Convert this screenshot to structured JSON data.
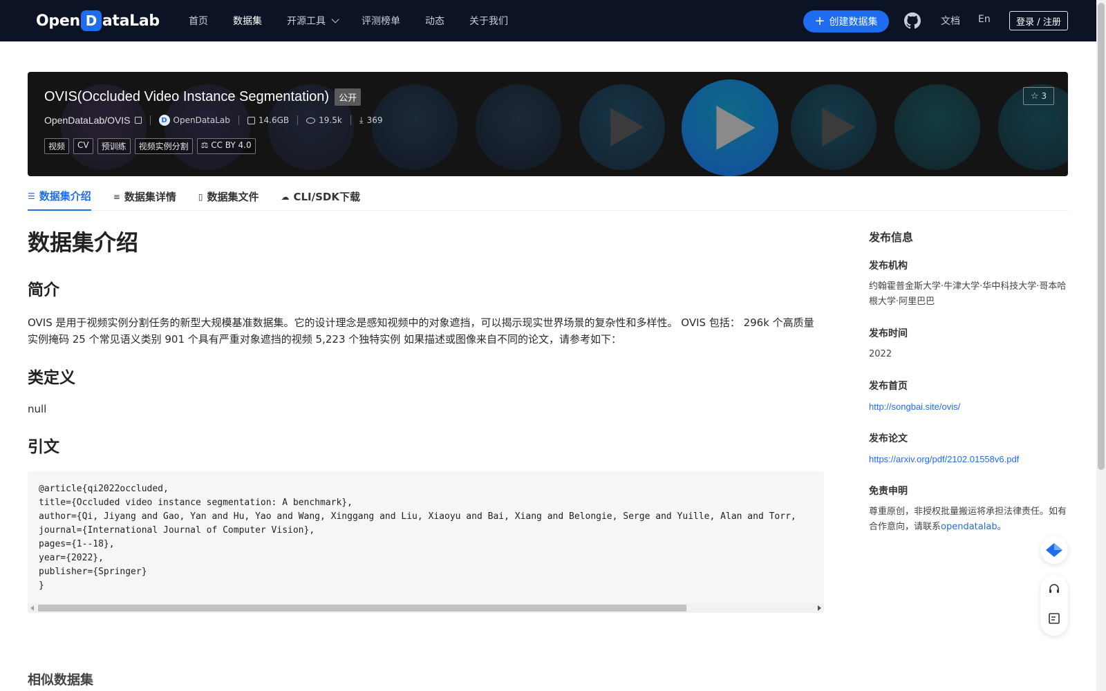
{
  "nav": {
    "logo_text_a": "Open",
    "logo_mark": "D",
    "logo_text_b": "ataLab",
    "items": [
      {
        "label": "首页"
      },
      {
        "label": "数据集"
      },
      {
        "label": "开源工具"
      },
      {
        "label": "评测榜单"
      },
      {
        "label": "动态"
      },
      {
        "label": "关于我们"
      }
    ],
    "create_label": "创建数据集",
    "docs_label": "文档",
    "lang_label": "En",
    "login_label": "登录 / 注册"
  },
  "banner": {
    "title": "OVIS(Occluded Video Instance Segmentation)",
    "visibility": "公开",
    "repo": "OpenDataLab/OVIS",
    "org": "OpenDataLab",
    "size": "14.6GB",
    "views": "19.5k",
    "downloads": "369",
    "tags": [
      "视频",
      "CV",
      "预训练",
      "视频实例分割"
    ],
    "license": "CC BY 4.0",
    "stars": "3"
  },
  "tabs": [
    {
      "label": "数据集介绍",
      "icon": "database-icon"
    },
    {
      "label": "数据集详情",
      "icon": "list-icon"
    },
    {
      "label": "数据集文件",
      "icon": "file-icon"
    },
    {
      "label": "CLI/SDK下载",
      "icon": "cloud-download-icon"
    }
  ],
  "content": {
    "h1": "数据集介绍",
    "intro_heading": "简介",
    "intro_text": "OVIS 是用于视频实例分割任务的新型大规模基准数据集。它的设计理念是感知视频中的对象遮挡，可以揭示现实世界场景的复杂性和多样性。 OVIS 包括： 296k 个高质量实例掩码 25 个常见语义类别 901 个具有严重对象遮挡的视频 5,223 个独特实例 如果描述或图像来自不同的论文，请参考如下：",
    "classdef_heading": "类定义",
    "classdef_text": "null",
    "citation_heading": "引文",
    "citation_code": "@article{qi2022occluded,\ntitle={Occluded video instance segmentation: A benchmark},\nauthor={Qi, Jiyang and Gao, Yan and Hu, Yao and Wang, Xinggang and Liu, Xiaoyu and Bai, Xiang and Belongie, Serge and Yuille, Alan and Torr,\njournal={International Journal of Computer Vision},\npages={1--18},\nyear={2022},\npublisher={Springer}\n}",
    "similar_heading": "相似数据集"
  },
  "sidebar": {
    "title": "发布信息",
    "org_label": "发布机构",
    "org_value": "约翰霍普金斯大学·牛津大学·华中科技大学·哥本哈根大学·阿里巴巴",
    "time_label": "发布时间",
    "time_value": "2022",
    "home_label": "发布首页",
    "home_value": "http://songbai.site/ovis/",
    "paper_label": "发布论文",
    "paper_value": "https://arxiv.org/pdf/2102.01558v6.pdf",
    "disclaimer_label": "免责申明",
    "disclaimer_text": "尊重原创，非授权批量搬运将承担法律责任。如有合作意向，请联系",
    "disclaimer_link": "opendatalab",
    "disclaimer_end": "。"
  }
}
